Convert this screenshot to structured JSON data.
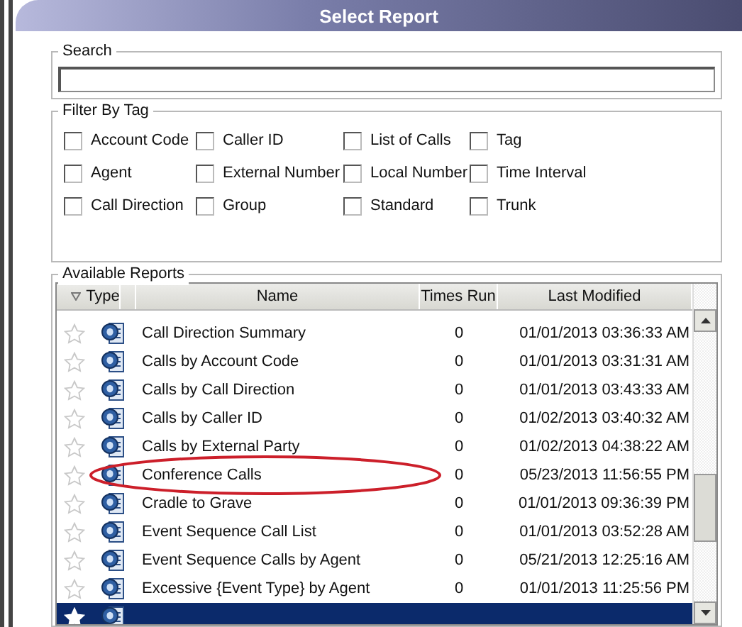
{
  "window": {
    "title": "Select Report"
  },
  "search": {
    "label": "Search"
  },
  "filter": {
    "label": "Filter By Tag",
    "tags": [
      {
        "label": "Account Code",
        "checked": false
      },
      {
        "label": "Caller ID",
        "checked": false
      },
      {
        "label": "List of Calls",
        "checked": false
      },
      {
        "label": "Tag",
        "checked": false
      },
      {
        "label": "Agent",
        "checked": false
      },
      {
        "label": "External Number",
        "checked": false
      },
      {
        "label": "Local Number",
        "checked": false
      },
      {
        "label": "Time Interval",
        "checked": false
      },
      {
        "label": "Call Direction",
        "checked": false
      },
      {
        "label": "Group",
        "checked": false
      },
      {
        "label": "Standard",
        "checked": false
      },
      {
        "label": "Trunk",
        "checked": false
      }
    ]
  },
  "reports": {
    "label": "Available Reports",
    "columns": [
      "Type",
      "Name",
      "Times Run",
      "Last Modified"
    ],
    "rows": [
      {
        "name": "Call Direction Summary",
        "times_run": "0",
        "last_modified": "01/01/2013 03:36:33 AM",
        "favorite": false,
        "selected": false
      },
      {
        "name": "Calls by Account Code",
        "times_run": "0",
        "last_modified": "01/01/2013 03:31:31 AM",
        "favorite": false,
        "selected": false
      },
      {
        "name": "Calls by Call Direction",
        "times_run": "0",
        "last_modified": "01/01/2013 03:43:33 AM",
        "favorite": false,
        "selected": false
      },
      {
        "name": "Calls by Caller ID",
        "times_run": "0",
        "last_modified": "01/02/2013 03:40:32 AM",
        "favorite": false,
        "selected": false
      },
      {
        "name": "Calls by External Party",
        "times_run": "0",
        "last_modified": "01/02/2013 04:38:22 AM",
        "favorite": false,
        "selected": false
      },
      {
        "name": "Conference Calls",
        "times_run": "0",
        "last_modified": "05/23/2013 11:56:55 PM",
        "favorite": false,
        "selected": false,
        "annotation": {
          "kind": "ellipse",
          "color": "#cc1f2a"
        }
      },
      {
        "name": "Cradle to Grave",
        "times_run": "0",
        "last_modified": "01/01/2013 09:36:39 PM",
        "favorite": false,
        "selected": false
      },
      {
        "name": "Event Sequence Call List",
        "times_run": "0",
        "last_modified": "01/01/2013 03:52:28 AM",
        "favorite": false,
        "selected": false
      },
      {
        "name": "Event Sequence Calls by Agent",
        "times_run": "0",
        "last_modified": "05/21/2013 12:25:16 AM",
        "favorite": false,
        "selected": false
      },
      {
        "name": "Excessive {Event Type} by Agent",
        "times_run": "0",
        "last_modified": "01/01/2013 11:25:56 PM",
        "favorite": false,
        "selected": false
      },
      {
        "favorite": false,
        "selected": true
      }
    ]
  }
}
